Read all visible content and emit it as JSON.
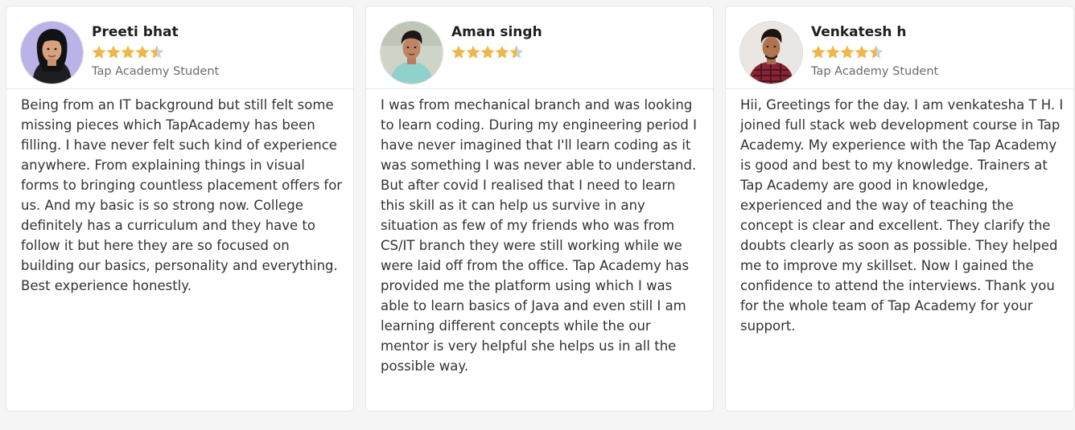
{
  "colors": {
    "star_filled": "#f0b64a",
    "star_empty": "#c6d3de",
    "card_background": "#ffffff",
    "page_background": "#f5f5f5"
  },
  "testimonials": [
    {
      "name": "Preeti bhat",
      "role": "Tap Academy Student",
      "rating": 4.5,
      "avatar_icon": "student-photo",
      "text": "Being from an IT background but still felt some missing pieces which TapAcademy has been filling. I have never felt such kind of experience anywhere. From explaining things in visual forms to bringing countless placement offers for us. And my basic is so strong now. College definitely has a curriculum and they have to follow it but here they are so focused on building our basics, personality and everything. Best experience honestly."
    },
    {
      "name": "Aman singh",
      "role": "",
      "rating": 4.5,
      "avatar_icon": "student-photo",
      "text": "I was from mechanical branch and was looking to learn coding. During my engineering period I have never imagined that I'll learn coding as it was something I was never able to understand. But after covid I realised that I need to learn this skill as it can help us survive in any situation as few of my friends who was from CS/IT branch they were still working while we were laid off from the office. Tap Academy has provided me the platform using which I was able to learn basics of Java and even still I am learning different concepts while the our mentor is very helpful she helps us in all the possible way."
    },
    {
      "name": "Venkatesh h",
      "role": "Tap Academy Student",
      "rating": 4.5,
      "avatar_icon": "student-photo",
      "text": "Hii, Greetings for the day. I am venkatesha T H. I joined full stack web development course in Tap Academy. My experience with the Tap Academy is good and best to my knowledge. Trainers at Tap Academy are good in knowledge, experienced and the way of teaching the concept is clear and excellent. They clarify the doubts clearly as soon as possible. They helped me to improve my skillset. Now I gained the confidence to attend the interviews. Thank you for the whole team of Tap Academy for your support."
    }
  ]
}
